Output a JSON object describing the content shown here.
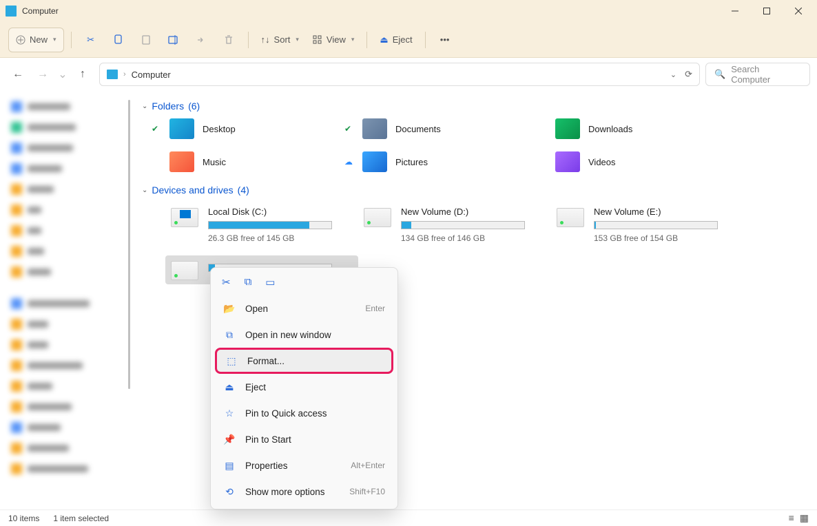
{
  "window": {
    "title": "Computer"
  },
  "toolbar": {
    "new": "New",
    "sort": "Sort",
    "view": "View",
    "eject": "Eject"
  },
  "nav": {
    "breadcrumb": "Computer",
    "search_placeholder": "Search Computer"
  },
  "sections": {
    "folders": {
      "label": "Folders",
      "count": "(6)"
    },
    "drives": {
      "label": "Devices and drives",
      "count": "(4)"
    }
  },
  "folders": [
    {
      "name": "Desktop",
      "badge": "check"
    },
    {
      "name": "Documents",
      "badge": "check"
    },
    {
      "name": "Downloads",
      "badge": ""
    },
    {
      "name": "Music",
      "badge": ""
    },
    {
      "name": "Pictures",
      "badge": "cloud"
    },
    {
      "name": "Videos",
      "badge": ""
    }
  ],
  "drives": [
    {
      "name": "Local Disk (C:)",
      "free": "26.3 GB free of 145 GB",
      "fill": 82
    },
    {
      "name": "New Volume (D:)",
      "free": "134 GB free of 146 GB",
      "fill": 8
    },
    {
      "name": "New Volume (E:)",
      "free": "153 GB free of 154 GB",
      "fill": 1
    },
    {
      "name": "",
      "free": "",
      "fill": 5,
      "selected": true
    }
  ],
  "context_menu": {
    "items": [
      {
        "label": "Open",
        "shortcut": "Enter",
        "icon": "folder"
      },
      {
        "label": "Open in new window",
        "shortcut": "",
        "icon": "window"
      },
      {
        "label": "Format...",
        "shortcut": "",
        "icon": "format",
        "highlight": true
      },
      {
        "label": "Eject",
        "shortcut": "",
        "icon": "eject"
      },
      {
        "label": "Pin to Quick access",
        "shortcut": "",
        "icon": "star"
      },
      {
        "label": "Pin to Start",
        "shortcut": "",
        "icon": "pin"
      },
      {
        "label": "Properties",
        "shortcut": "Alt+Enter",
        "icon": "props"
      },
      {
        "label": "Show more options",
        "shortcut": "Shift+F10",
        "icon": "more"
      }
    ]
  },
  "status": {
    "items": "10 items",
    "selected": "1 item selected"
  }
}
